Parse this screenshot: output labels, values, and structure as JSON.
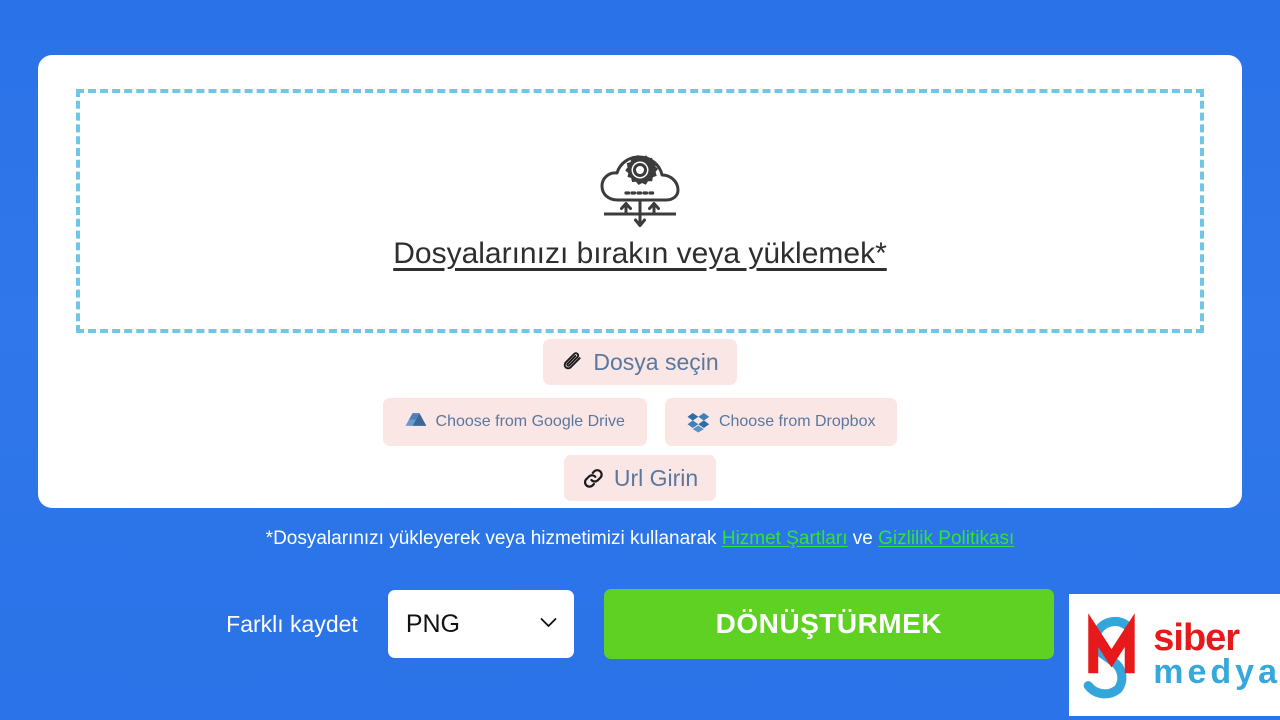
{
  "theme": {
    "background_blue": "#2a73e8",
    "dashed_border": "#6ec6e8",
    "pink_button_bg": "#fbe6e6",
    "pink_button_text": "#5a789d",
    "convert_green": "#5fd123",
    "link_green": "#2ee62e"
  },
  "dropzone": {
    "icon": "cloud-upload-gear-icon",
    "text": "Dosyalarınızı bırakın veya yüklemek*"
  },
  "sources": {
    "choose_file": {
      "label": "Dosya seçin",
      "icon": "paperclip-icon"
    },
    "google_drive": {
      "label": "Choose from Google Drive",
      "icon": "google-drive-icon"
    },
    "dropbox": {
      "label": "Choose from Dropbox",
      "icon": "dropbox-icon"
    },
    "url": {
      "label": "Url Girin",
      "icon": "link-icon"
    }
  },
  "note": {
    "prefix": "*Dosyalarınızı yükleyerek veya hizmetimizi kullanarak ",
    "terms_link": "Hizmet Şartları",
    "middle": " ve ",
    "privacy_link": "Gizlilik Politikası"
  },
  "controls": {
    "save_as_label": "Farklı kaydet",
    "format_value": "PNG",
    "format_options": [
      "PNG"
    ],
    "convert_label": "DÖNÜŞTÜRMEK",
    "chevron": "chevron-down-icon"
  },
  "logo": {
    "mark": "m-s-monogram-icon",
    "line1": "siber",
    "line2": "medya"
  }
}
